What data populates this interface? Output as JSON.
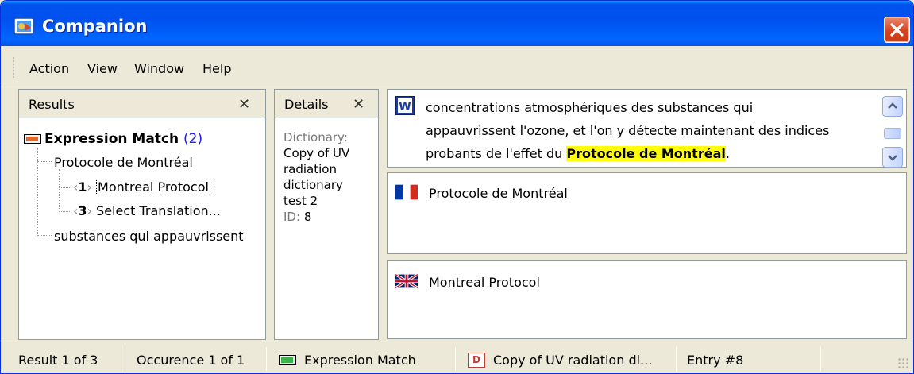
{
  "window": {
    "title": "Companion"
  },
  "menu": {
    "items": [
      "Action",
      "View",
      "Window",
      "Help"
    ]
  },
  "results": {
    "title": "Results",
    "root_label": "Expression Match",
    "root_count": "(2)",
    "child_label": "Protocole de Montréal",
    "entries": [
      {
        "num": "1",
        "text": "Montreal Protocol"
      },
      {
        "num": "3",
        "text": "Select Translation..."
      }
    ],
    "second_child": "substances qui appauvrissent"
  },
  "details": {
    "title": "Details",
    "dictionary_label": "Dictionary:",
    "dictionary_lines": [
      "Copy of UV",
      "radiation",
      "dictionary",
      "test 2"
    ],
    "id_label": "ID:",
    "id_value": "8"
  },
  "context": {
    "line1": "concentrations atmosphériques des substances qui",
    "line2": "appauvrissent l'ozone, et l'on y détecte maintenant des indices",
    "line3_before": "probants de l'effet du ",
    "line3_highlight": "Protocole de Montréal",
    "line3_after": "."
  },
  "source": {
    "text": "Protocole de Montréal",
    "flag": "french-flag-icon"
  },
  "target": {
    "text": "Montreal Protocol",
    "flag": "uk-flag-icon"
  },
  "status": {
    "result": "Result 1 of 3",
    "occurrence": "Occurence 1 of 1",
    "match_type": "Expression Match",
    "dictionary": "Copy of UV radiation di...",
    "dict_badge": "D",
    "entry": "Entry #8"
  },
  "colors": {
    "title_bar": "#0055ea",
    "highlight": "#ffff00",
    "count": "#0000ff"
  }
}
